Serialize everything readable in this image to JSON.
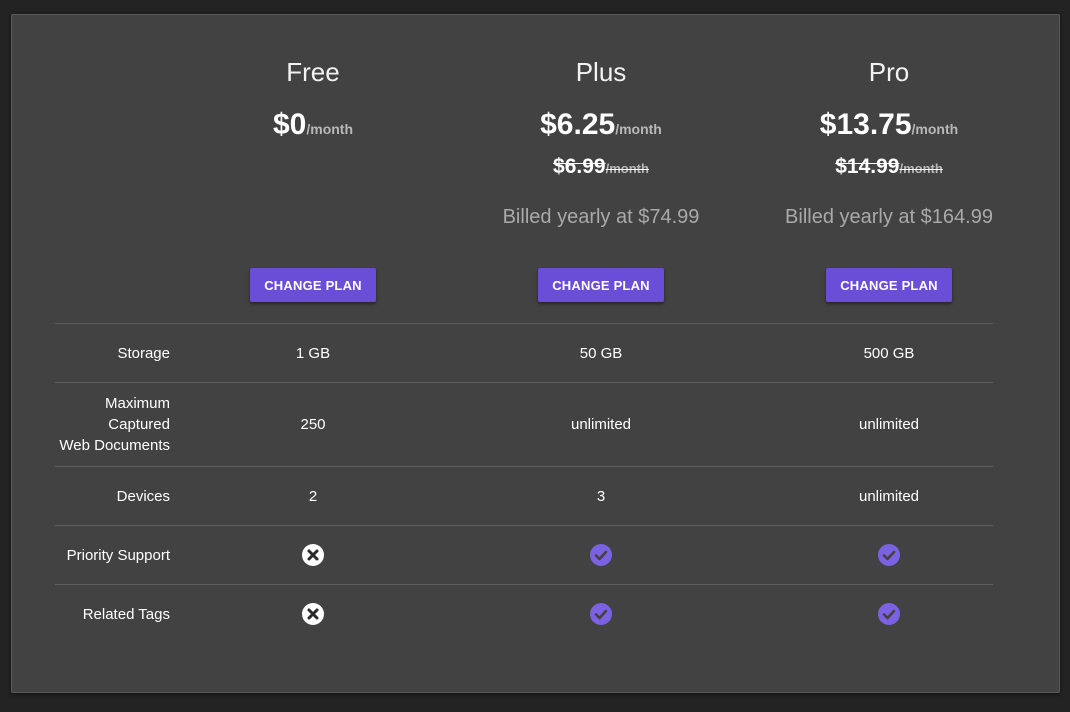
{
  "plans": [
    {
      "name": "Free",
      "price": "$0",
      "per": "/month",
      "old_price": "",
      "old_per": "",
      "billed": "",
      "button": "CHANGE PLAN"
    },
    {
      "name": "Plus",
      "price": "$6.25",
      "per": "/month",
      "old_price": "$6.99",
      "old_per": "/month",
      "billed": "Billed yearly at $74.99",
      "button": "CHANGE PLAN"
    },
    {
      "name": "Pro",
      "price": "$13.75",
      "per": "/month",
      "old_price": "$14.99",
      "old_per": "/month",
      "billed": "Billed yearly at $164.99",
      "button": "CHANGE PLAN"
    }
  ],
  "features": [
    {
      "label": "Storage",
      "free": "1 GB",
      "plus": "50 GB",
      "pro": "500 GB"
    },
    {
      "label_lines": [
        "Maximum",
        "Captured",
        "Web Documents"
      ],
      "free": "250",
      "plus": "unlimited",
      "pro": "unlimited"
    },
    {
      "label": "Devices",
      "free": "2",
      "plus": "3",
      "pro": "unlimited"
    },
    {
      "label": "Priority Support",
      "free_icon": "x-circle-icon",
      "plus_icon": "check-circle-icon",
      "pro_icon": "check-circle-icon"
    },
    {
      "label": "Related Tags",
      "free_icon": "x-circle-icon",
      "plus_icon": "check-circle-icon",
      "pro_icon": "check-circle-icon"
    }
  ],
  "colors": {
    "background": "#232323",
    "card": "#424242",
    "accent": "#6a4ed8",
    "check": "#7a62e0",
    "muted_text": "#a9a9a9"
  }
}
